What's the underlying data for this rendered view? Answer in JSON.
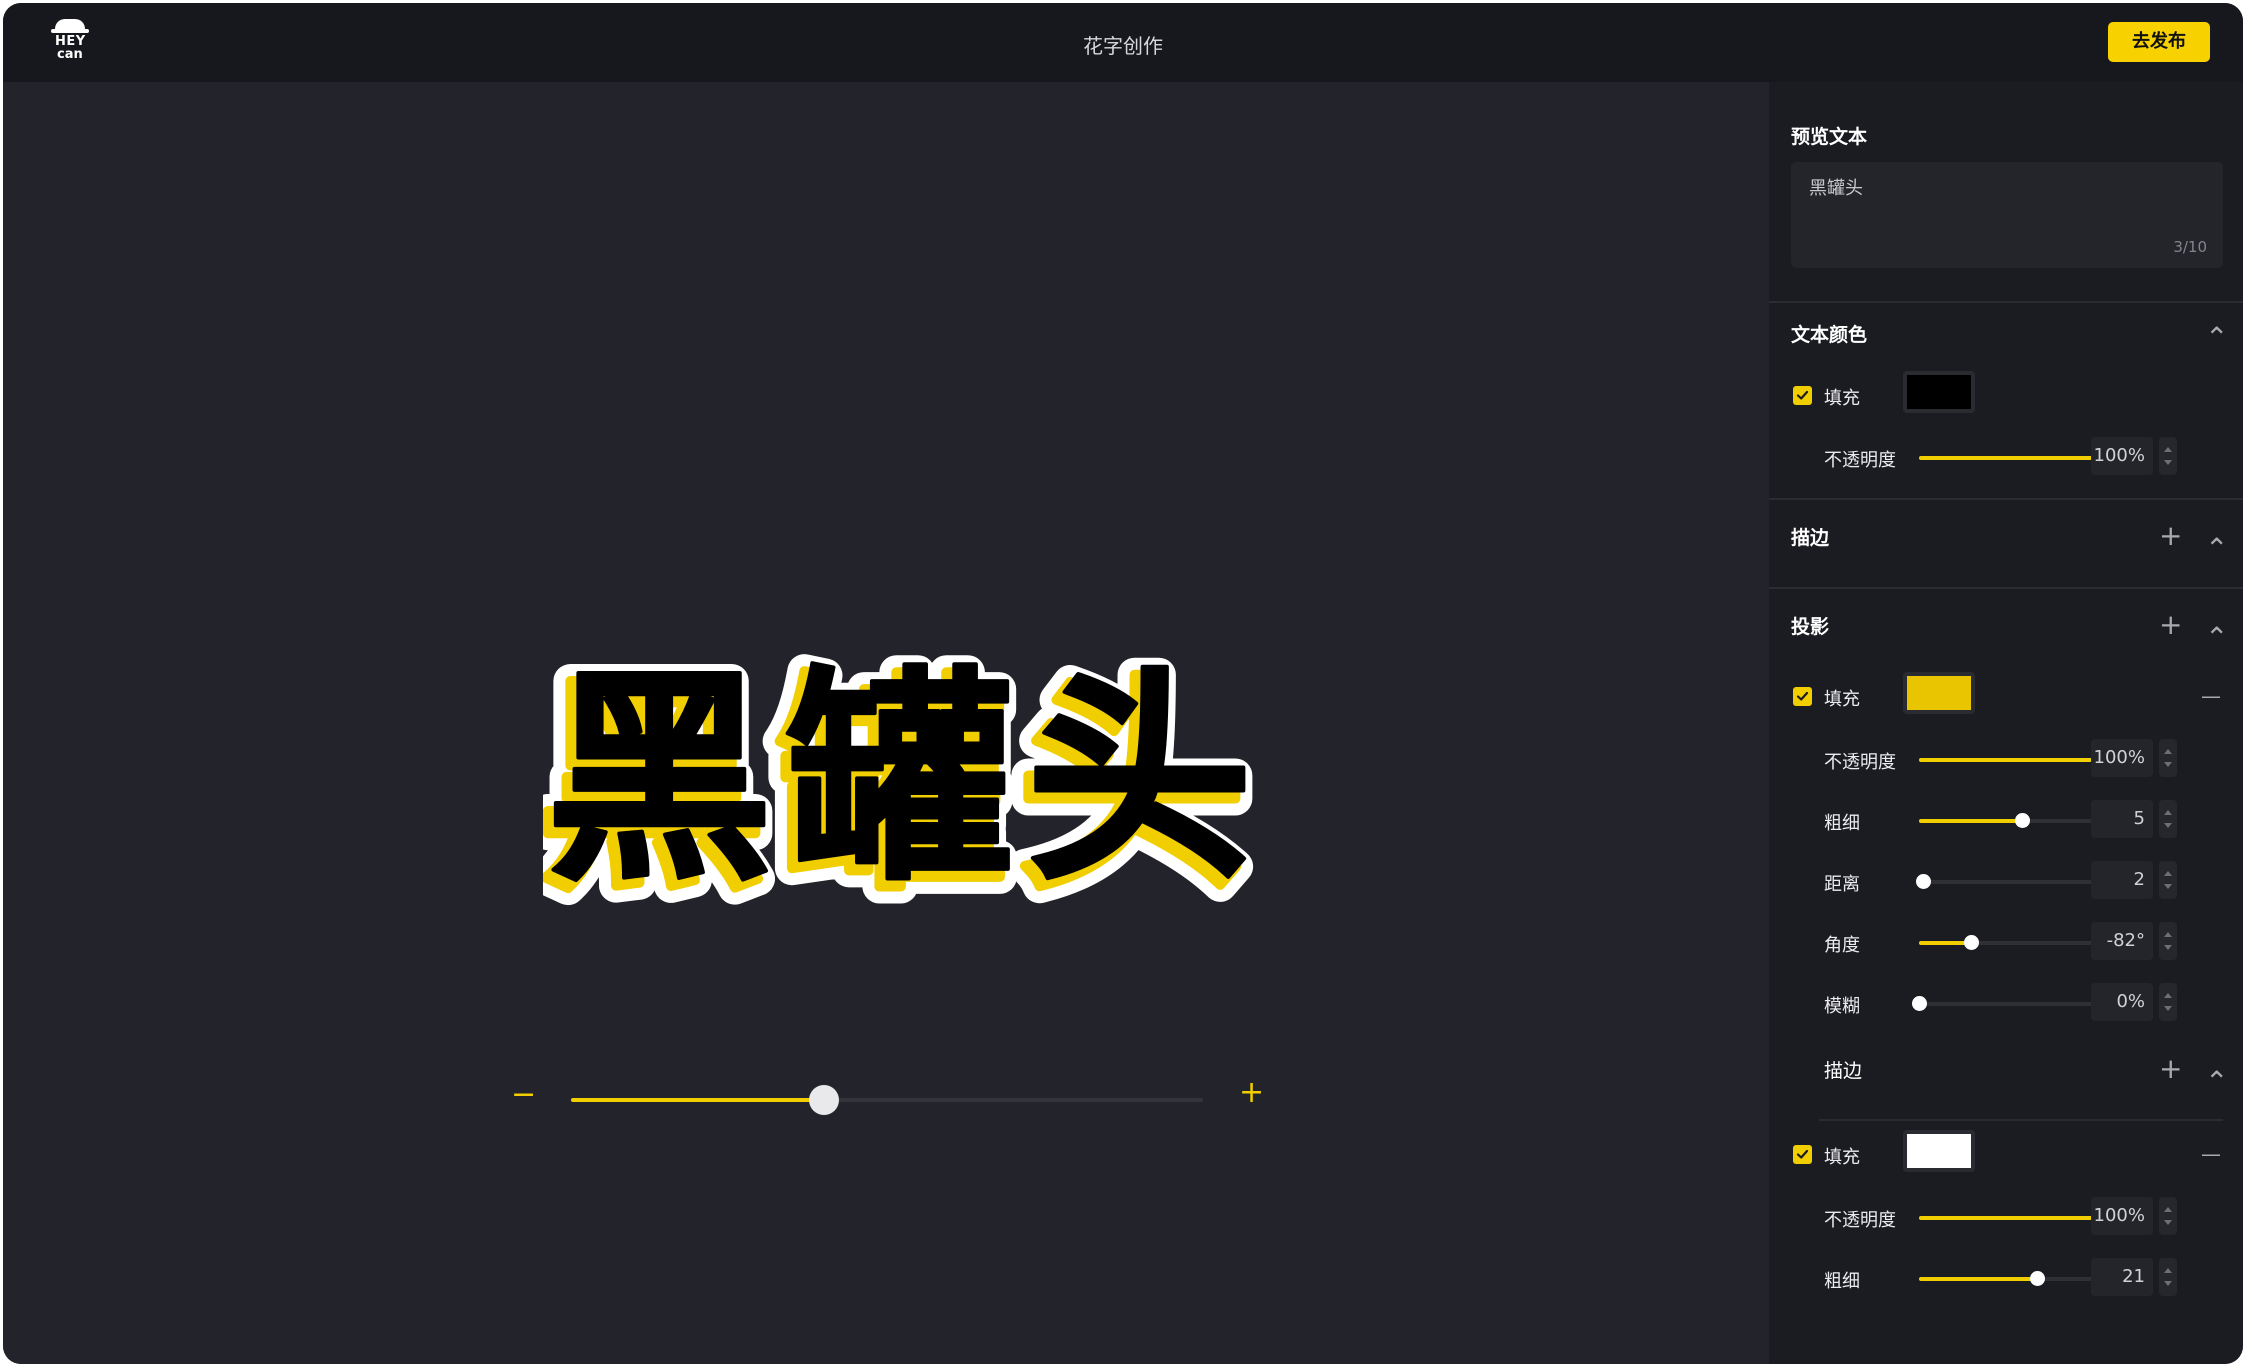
{
  "app": {
    "logo_line1": "HEY",
    "logo_line2": "can",
    "title": "花字创作",
    "publish_label": "去发布"
  },
  "canvas": {
    "art_text": [
      "黑",
      "罐",
      "头"
    ],
    "colors": {
      "fill": "#000000",
      "shadow": "#f1ce00",
      "stroke": "#ffffff"
    },
    "zoom": {
      "minus_icon": "−",
      "plus_icon": "+",
      "level": 0.4
    }
  },
  "panel": {
    "preview": {
      "title": "预览文本",
      "value": "黑罐头",
      "count": "3/10"
    },
    "text_color": {
      "title": "文本颜色",
      "fill_label": "填充",
      "fill_checked": true,
      "fill_color": "#000000",
      "opacity": {
        "label": "不透明度",
        "value": "100%",
        "level": 1.0
      }
    },
    "stroke": {
      "title": "描边"
    },
    "shadow": {
      "title": "投影",
      "fill_label": "填充",
      "fill_checked": true,
      "fill_color": "#e8c500",
      "opacity": {
        "label": "不透明度",
        "value": "100%",
        "level": 1.0
      },
      "thickness": {
        "label": "粗细",
        "value": "5",
        "level": 0.53
      },
      "distance": {
        "label": "距离",
        "value": "2",
        "level": 0.02
      },
      "angle": {
        "label": "角度",
        "value": "-82°",
        "level": 0.27
      },
      "blur": {
        "label": "模糊",
        "value": "0%",
        "level": 0.0
      },
      "stroke": {
        "title": "描边",
        "fill_label": "填充",
        "fill_checked": true,
        "fill_color": "#ffffff",
        "opacity": {
          "label": "不透明度",
          "value": "100%",
          "level": 1.0
        },
        "thickness": {
          "label": "粗细",
          "value": "21",
          "level": 0.61
        }
      }
    }
  },
  "icons": {
    "plus": "+",
    "chevron_up": "⌃",
    "minus": "—"
  }
}
